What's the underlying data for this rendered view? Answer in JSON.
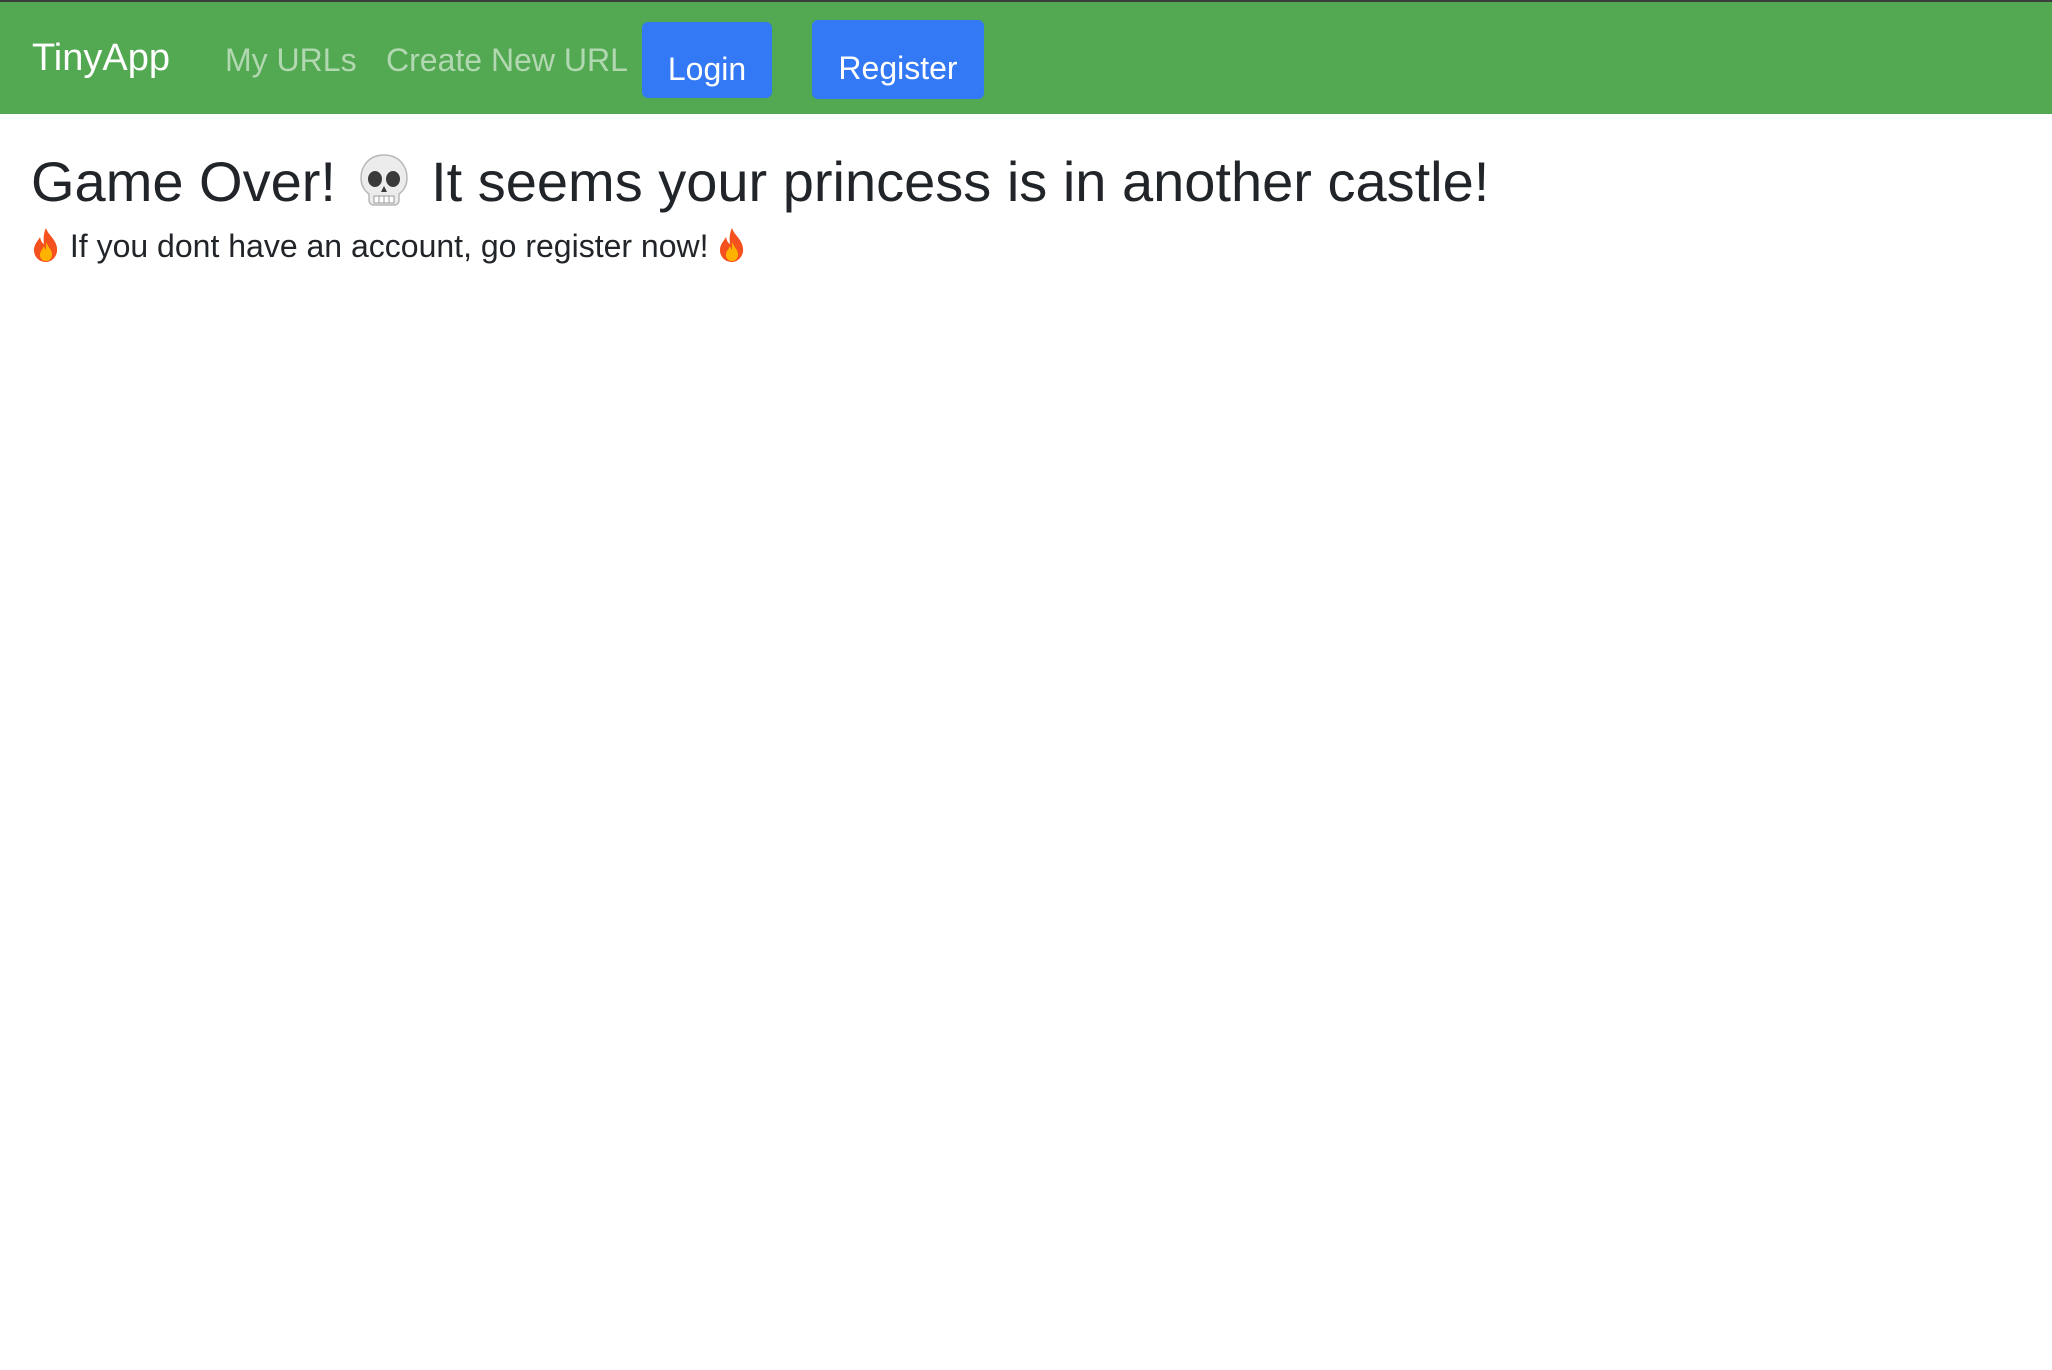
{
  "navbar": {
    "brand": "TinyApp",
    "links": [
      {
        "label": "My URLs"
      },
      {
        "label": "Create New URL"
      }
    ],
    "login_label": "Login",
    "register_label": "Register",
    "colors": {
      "background": "#53a852",
      "button": "#3379f6"
    }
  },
  "main": {
    "heading_part1": "Game Over!",
    "heading_icon": "skull-icon",
    "heading_part2": "It seems your princess is in another castle!",
    "subtext_icon": "fire-icon",
    "subtext": "If you dont have an account, go register now!"
  }
}
